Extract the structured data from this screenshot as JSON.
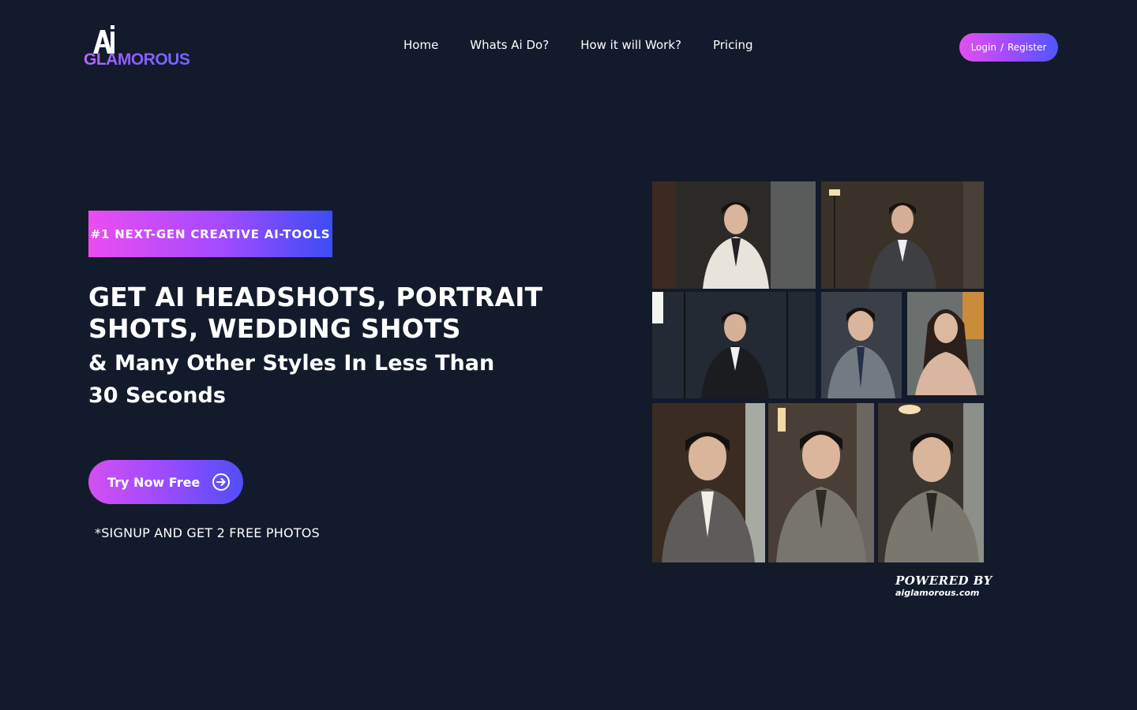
{
  "brand": {
    "name_top": "Ai",
    "name": "GLAMOROUS"
  },
  "nav": {
    "items": [
      {
        "label": "Home"
      },
      {
        "label": "Whats Ai Do?"
      },
      {
        "label": "How it will Work?"
      },
      {
        "label": "Pricing"
      }
    ],
    "login_label": "Login",
    "separator": "/",
    "register_label": "Register"
  },
  "hero": {
    "badge": "#1 NEXT-GEN CREATIVE AI-TOOLS",
    "headline": "GET AI HEADSHOTS, PORTRAIT SHOTS, WEDDING SHOTS",
    "subline": "& Many Other Styles In Less Than 30 Seconds",
    "cta_label": "Try Now Free",
    "cta_icon": "arrow-circle-right-icon",
    "note": "*SIGNUP AND GET 2 FREE PHOTOS"
  },
  "collage": {
    "powered_by": "POWERED BY",
    "site": "aiglamorous.com",
    "photo_count": 9
  },
  "colors": {
    "background": "#131a2b",
    "gradient_pink": "#e34ff0",
    "gradient_purple": "#9a4bff",
    "gradient_blue": "#4d56ff"
  }
}
